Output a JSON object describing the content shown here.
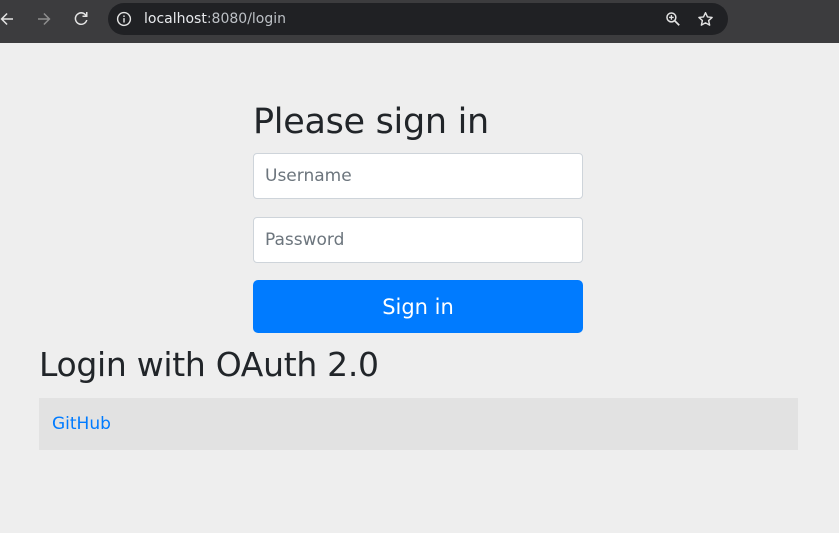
{
  "browser": {
    "url_host": "localhost",
    "url_rest": ":8080/login",
    "icons": {
      "back": "back-arrow-icon",
      "forward": "forward-arrow-icon",
      "reload": "reload-icon",
      "site_info": "info-icon",
      "zoom": "zoom-in-icon",
      "bookmark": "star-icon"
    }
  },
  "login_form": {
    "heading": "Please sign in",
    "username_placeholder": "Username",
    "password_placeholder": "Password",
    "submit_label": "Sign in"
  },
  "oauth": {
    "heading": "Login with OAuth 2.0",
    "providers": [
      {
        "label": "GitHub"
      }
    ]
  },
  "colors": {
    "page_background": "#eeeeee",
    "primary_button": "#007bff",
    "link": "#007bff",
    "oauth_row_background": "#e2e2e2"
  }
}
